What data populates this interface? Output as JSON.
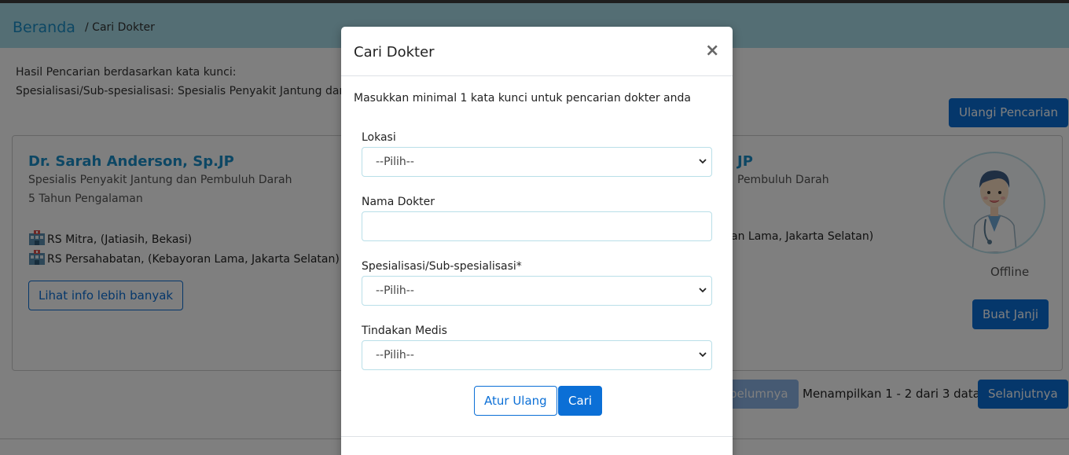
{
  "breadcrumb": {
    "home": "Beranda",
    "current": "/ Cari Dokter"
  },
  "search_info": {
    "line1": "Hasil Pencarian berdasarkan kata kunci:",
    "line2": "Spesialisasi/Sub-spesialisasi: Spesialis Penyakit Jantung dan"
  },
  "reset_search_label": "Ulangi Pencarian",
  "doctor_card": {
    "name": "Dr. Sarah Anderson, Sp.JP",
    "specialty": "Spesialis Penyakit Jantung dan Pembuluh Darah",
    "experience": "5 Tahun Pengalaman",
    "hospitals": [
      "RS Mitra, (Jatiasih, Bekasi)",
      "RS Persahabatan, (Kebayoran Lama, Jakarta Selatan)"
    ],
    "info_button": "Lihat info lebih banyak",
    "name_partial": "JP",
    "specialty_partial": "Pembuluh Darah",
    "hospital_partial": "an Lama, Jakarta Selatan)",
    "status": "Offline",
    "appointment_button": "Buat Janji"
  },
  "pagination": {
    "prev_label": "pelumnya",
    "info": "Menampilkan 1 - 2 dari 3 data",
    "next_label": "Selanjutnya"
  },
  "modal": {
    "title": "Cari Dokter",
    "close": "×",
    "intro": "Masukkan minimal 1 kata kunci untuk pencarian dokter anda",
    "fields": {
      "location": {
        "label": "Lokasi",
        "value": "--Pilih--"
      },
      "doctor_name": {
        "label": "Nama Dokter",
        "value": ""
      },
      "specialty": {
        "label": "Spesialisasi/Sub-spesialisasi*",
        "value": "--Pilih--"
      },
      "procedure": {
        "label": "Tindakan Medis",
        "value": "--Pilih--"
      }
    },
    "reset_button": "Atur Ulang",
    "search_button": "Cari"
  },
  "colors": {
    "primary": "#0b6fd6",
    "link": "#1a8fc9",
    "header_bg": "#a8dde8",
    "input_border": "#b9dfe8"
  }
}
